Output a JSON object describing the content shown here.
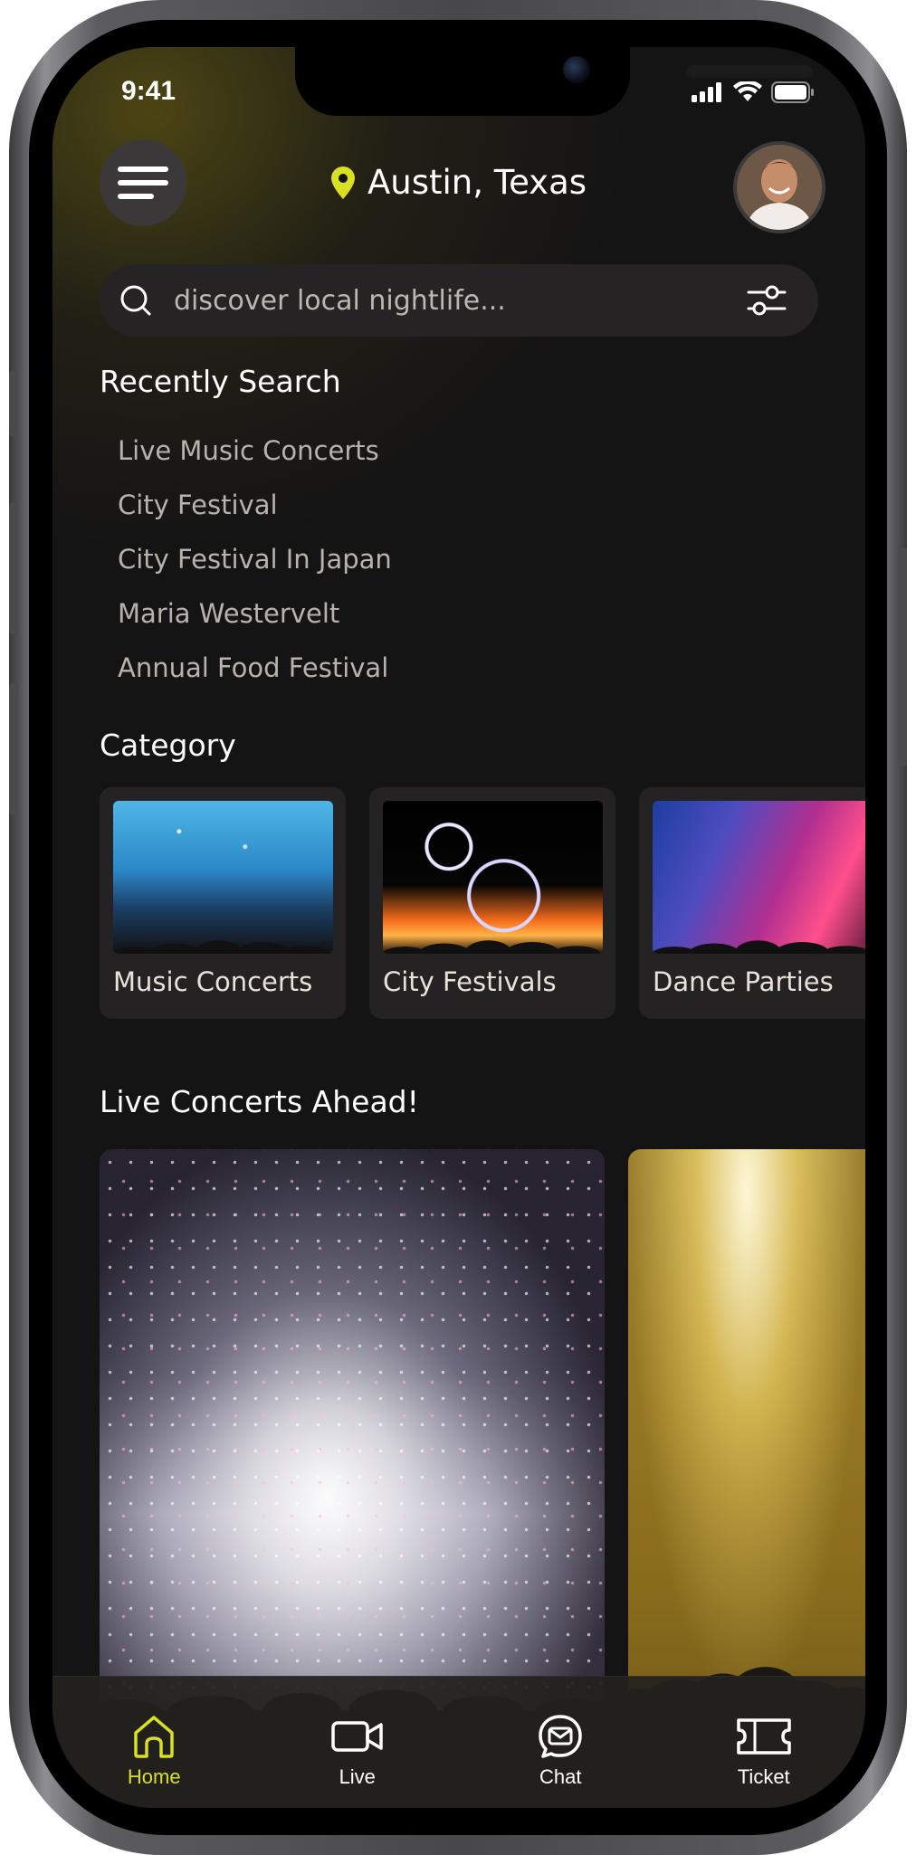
{
  "status_bar": {
    "time": "9:41"
  },
  "header": {
    "location": "Austin, Texas"
  },
  "search": {
    "placeholder": "discover local nightlife..."
  },
  "recent": {
    "title": "Recently Search",
    "items": [
      "Live Music Concerts",
      "City Festival",
      "City Festival In Japan",
      "Maria Westervelt",
      "Annual Food Festival"
    ]
  },
  "category": {
    "title": "Category",
    "items": [
      {
        "label": "Music Concerts"
      },
      {
        "label": "City Festivals"
      },
      {
        "label": "Dance Parties"
      }
    ]
  },
  "live": {
    "title": "Live Concerts Ahead!"
  },
  "nav": {
    "items": [
      {
        "label": "Home",
        "icon": "home-icon",
        "active": true
      },
      {
        "label": "Live",
        "icon": "video-camera-icon",
        "active": false
      },
      {
        "label": "Chat",
        "icon": "chat-icon",
        "active": false
      },
      {
        "label": "Ticket",
        "icon": "ticket-icon",
        "active": false
      }
    ]
  },
  "colors": {
    "accent": "#d9e021",
    "background": "#151415",
    "card": "#242223"
  }
}
